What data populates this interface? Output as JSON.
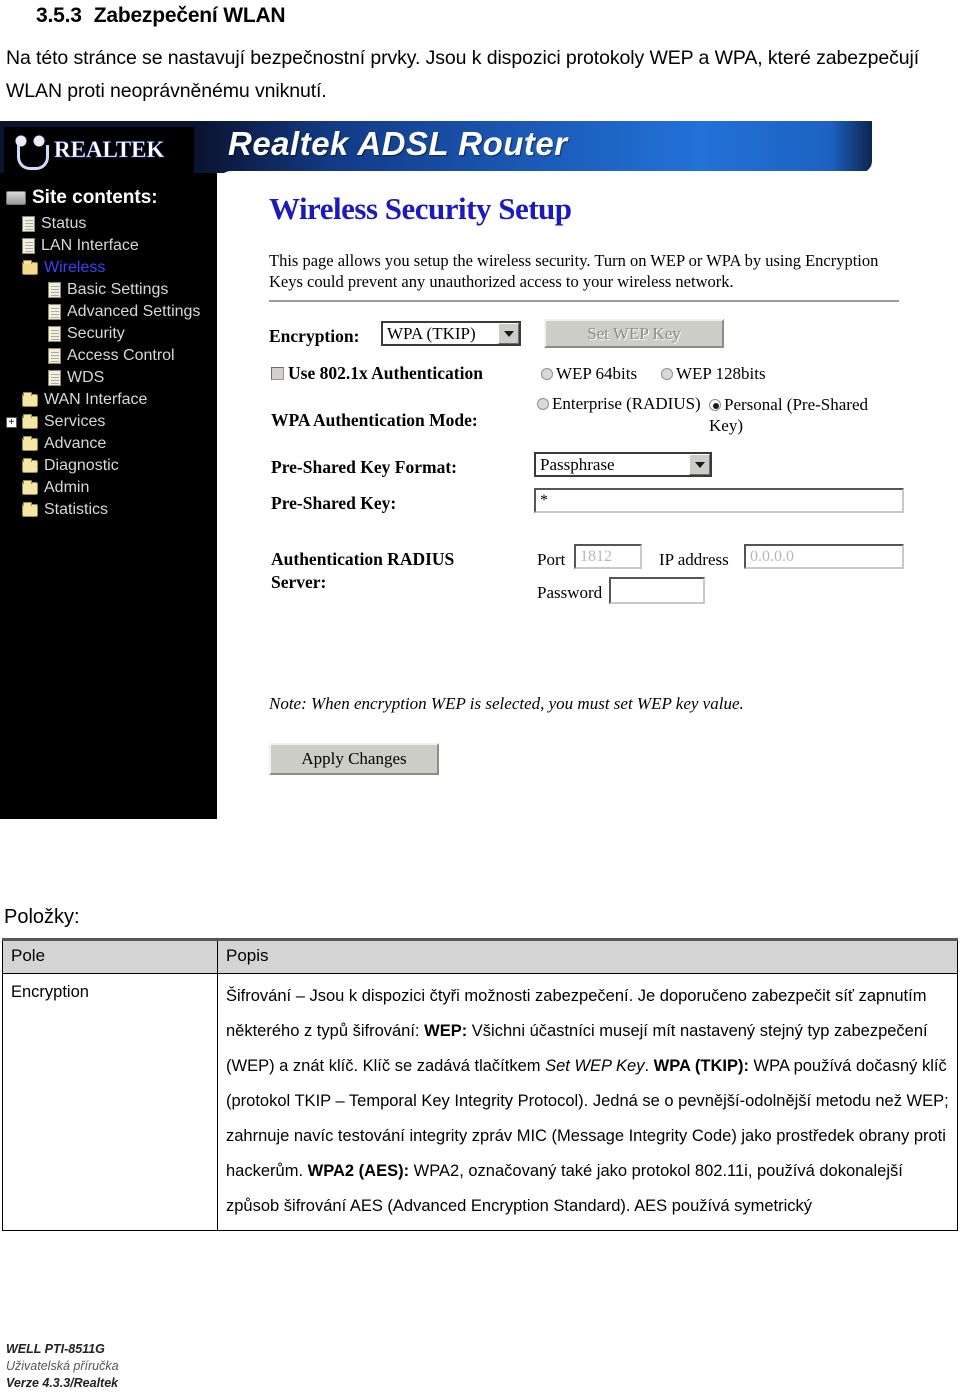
{
  "document": {
    "heading_number": "3.5.3",
    "heading_title": "Zabezpečení WLAN",
    "intro": "Na této stránce se nastavují bezpečnostní prvky. Jsou k dispozici protokoly WEP a WPA, které zabezpečují WLAN proti neoprávněnému vniknutí.",
    "section_label": "Položky:"
  },
  "router": {
    "logo_text": "REALTEK",
    "banner_title": "Realtek ADSL Router",
    "nav": {
      "root_label": "Site contents:",
      "items": [
        {
          "label": "Status",
          "icon": "page-icon",
          "level": 1,
          "selected": false,
          "expander": false
        },
        {
          "label": "LAN Interface",
          "icon": "page-icon",
          "level": 1,
          "selected": false,
          "expander": false
        },
        {
          "label": "Wireless",
          "icon": "folder-open-icon",
          "level": 1,
          "selected": true,
          "expander": false
        },
        {
          "label": "Basic Settings",
          "icon": "page-icon",
          "level": 2,
          "selected": false,
          "expander": false
        },
        {
          "label": "Advanced Settings",
          "icon": "page-icon",
          "level": 2,
          "selected": false,
          "expander": false
        },
        {
          "label": "Security",
          "icon": "page-icon",
          "level": 2,
          "selected": false,
          "expander": false
        },
        {
          "label": "Access Control",
          "icon": "page-icon",
          "level": 2,
          "selected": false,
          "expander": false
        },
        {
          "label": "WDS",
          "icon": "page-icon",
          "level": 2,
          "selected": false,
          "expander": false
        },
        {
          "label": "WAN Interface",
          "icon": "folder-icon",
          "level": 1,
          "selected": false,
          "expander": false
        },
        {
          "label": "Services",
          "icon": "folder-icon",
          "level": 1,
          "selected": false,
          "expander": true
        },
        {
          "label": "Advance",
          "icon": "folder-icon",
          "level": 1,
          "selected": false,
          "expander": false
        },
        {
          "label": "Diagnostic",
          "icon": "folder-icon",
          "level": 1,
          "selected": false,
          "expander": false
        },
        {
          "label": "Admin",
          "icon": "folder-icon",
          "level": 1,
          "selected": false,
          "expander": false
        },
        {
          "label": "Statistics",
          "icon": "folder-icon",
          "level": 1,
          "selected": false,
          "expander": false
        }
      ]
    },
    "page": {
      "title": "Wireless Security Setup",
      "description": "This page allows you setup the wireless security. Turn on WEP or WPA by using Encryption Keys could prevent any unauthorized access to your wireless network.",
      "encryption_label": "Encryption:",
      "encryption_value": "WPA (TKIP)",
      "set_wep_key_button": "Set WEP Key",
      "use_8021x_label": "Use 802.1x Authentication",
      "wep64_label": "WEP 64bits",
      "wep128_label": "WEP 128bits",
      "wpa_auth_mode_label": "WPA Authentication Mode:",
      "enterprise_label": "Enterprise (RADIUS)",
      "personal_label": "Personal (Pre-Shared Key)",
      "psk_format_label": "Pre-Shared Key Format:",
      "psk_format_value": "Passphrase",
      "psk_label": "Pre-Shared Key:",
      "psk_value": "*",
      "radius_label_line1": "Authentication RADIUS",
      "radius_label_line2": "Server:",
      "port_label": "Port",
      "port_value": "1812",
      "ip_label": "IP address",
      "ip_value": "0.0.0.0",
      "password_label": "Password",
      "password_value": "",
      "note": "Note: When encryption WEP is selected, you must set WEP key value.",
      "apply_button": "Apply Changes"
    }
  },
  "table": {
    "headers": {
      "col1": "Pole",
      "col2": "Popis"
    },
    "row": {
      "field": "Encryption",
      "p1": "Šifrování – Jsou k dispozici čtyři možnosti zabezpečení. Je doporučeno zabezpečit síť zapnutím některého z typů šifrování:",
      "wep_term": "WEP:",
      "wep_text": " Všichni účastníci musejí mít nastavený stejný typ zabezpečení (WEP) a znát klíč. Klíč se zadává tlačítkem ",
      "wep_italic": "Set WEP Key",
      "wep_tail": ".",
      "wpa_term": "WPA (TKIP):",
      "wpa_text": " WPA používá dočasný klíč (protokol TKIP – Temporal Key Integrity Protocol). Jedná se o pevnější-odolnější metodu než WEP; zahrnuje navíc testování integrity zpráv MIC (Message Integrity Code) jako prostředek obrany proti hackerům.",
      "wpa2_term": "WPA2 (AES):",
      "wpa2_text": "   WPA2, označovaný také jako protokol 802.11i, používá dokonalejší způsob šifrování AES (Advanced Encryption Standard). AES používá symetrický"
    }
  },
  "footer": {
    "line1": "WELL PTI-8511G",
    "line2": "Uživatelská příručka",
    "line3": "Verze 4.3.3/Realtek"
  }
}
